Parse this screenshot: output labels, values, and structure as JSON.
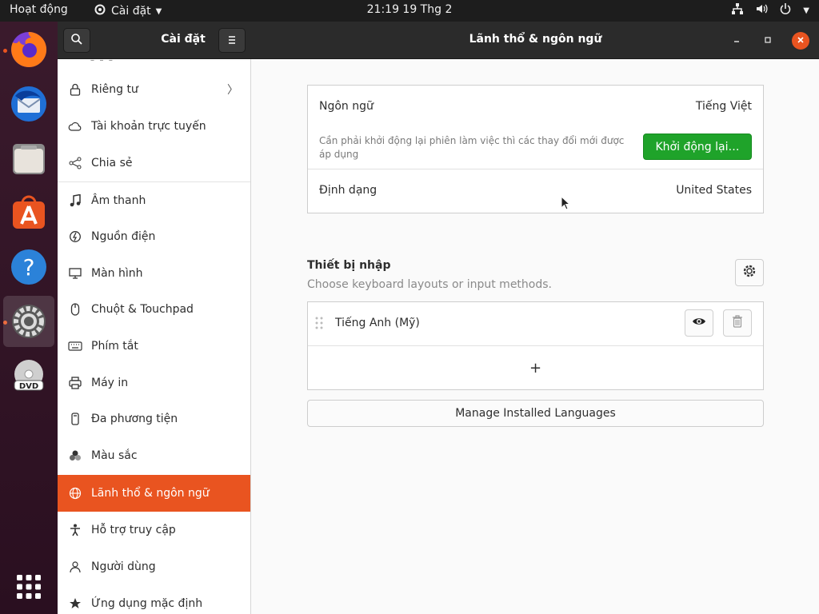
{
  "topbar": {
    "activities": "Hoạt động",
    "app_menu": "Cài đặt",
    "clock": "21:19  19 Thg 2"
  },
  "dock": {
    "items": [
      "firefox-icon",
      "thunderbird-icon",
      "files-icon",
      "software-icon",
      "help-icon",
      "settings-icon",
      "dvd-icon",
      "show-apps-icon"
    ]
  },
  "headerbar": {
    "sidebar_title": "Cài đặt",
    "main_title": "Lãnh thổ & ngôn ngữ"
  },
  "sidebar": {
    "items": [
      {
        "label": "Riêng tư",
        "icon": "lock-icon"
      },
      {
        "label": "Tài khoản trực tuyến",
        "icon": "cloud-icon"
      },
      {
        "label": "Chia sẻ",
        "icon": "share-icon"
      },
      {
        "label": "Âm thanh",
        "icon": "music-icon"
      },
      {
        "label": "Nguồn điện",
        "icon": "power-icon"
      },
      {
        "label": "Màn hình",
        "icon": "display-icon"
      },
      {
        "label": "Chuột & Touchpad",
        "icon": "mouse-icon"
      },
      {
        "label": "Phím tắt",
        "icon": "keyboard-icon"
      },
      {
        "label": "Máy in",
        "icon": "printer-icon"
      },
      {
        "label": "Đa phương tiện",
        "icon": "media-icon"
      },
      {
        "label": "Màu sắc",
        "icon": "color-icon"
      },
      {
        "label": "Lãnh thổ & ngôn ngữ",
        "icon": "globe-icon"
      },
      {
        "label": "Hỗ trợ truy cập",
        "icon": "accessibility-icon"
      },
      {
        "label": "Người dùng",
        "icon": "users-icon"
      },
      {
        "label": "Ứng dụng mặc định",
        "icon": "star-icon"
      }
    ],
    "selected_label": "Lãnh thổ & ngôn ngữ"
  },
  "language_frame": {
    "language_label": "Ngôn ngữ",
    "language_value": "Tiếng Việt",
    "restart_note": "Cần phải khởi động lại phiên làm việc thì các thay đổi mới được áp dụng",
    "restart_button": "Khởi động lại…",
    "format_label": "Định dạng",
    "format_value": "United States"
  },
  "input_sources": {
    "title": "Thiết bị nhập",
    "subtitle": "Choose keyboard layouts or input methods.",
    "items": [
      {
        "label": "Tiếng Anh (Mỹ)"
      }
    ],
    "add_symbol": "+"
  },
  "manage_button": "Manage Installed Languages",
  "colors": {
    "accent": "#e95420",
    "restart_green": "#1fa32a",
    "headerbar": "#2b2b2b"
  }
}
